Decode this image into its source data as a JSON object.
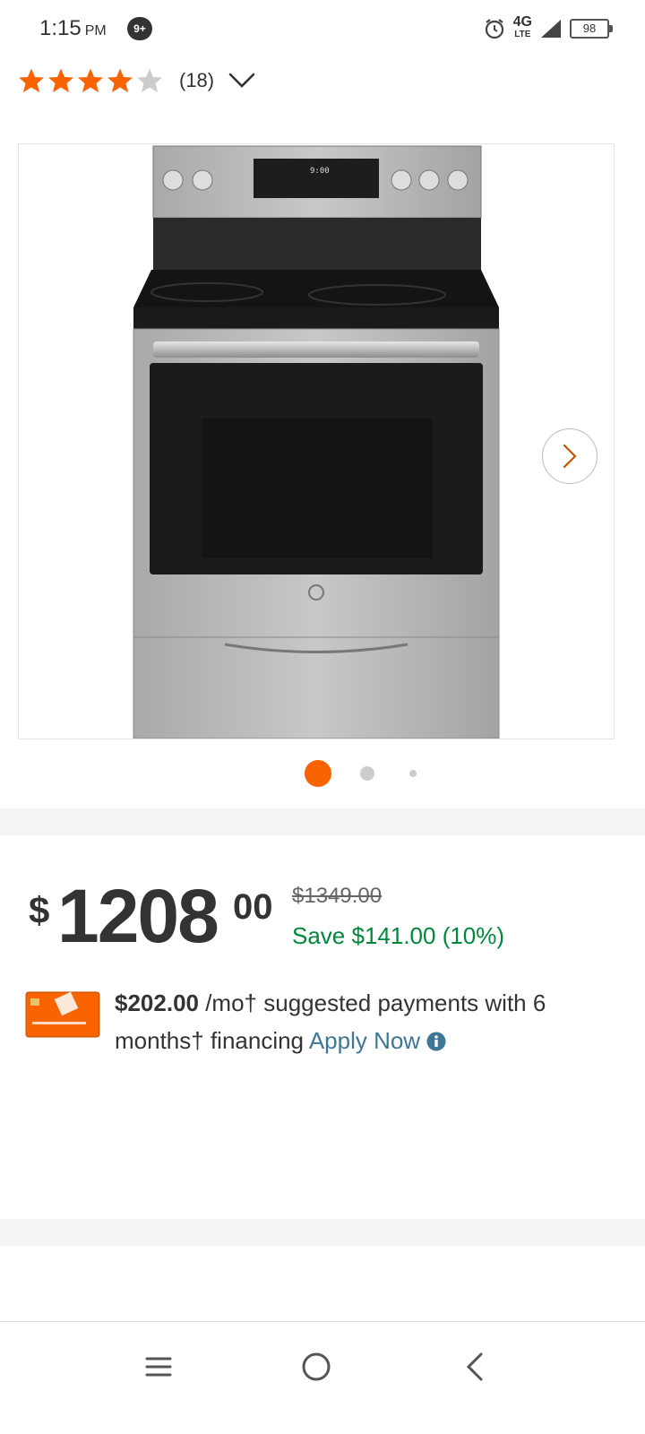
{
  "status_bar": {
    "time": "1:15",
    "ampm": "PM",
    "notification_badge": "9+",
    "network": "4G",
    "network_sub": "LTE",
    "battery": "98"
  },
  "rating": {
    "stars_filled": 4,
    "stars_total": 5,
    "review_count": "(18)"
  },
  "carousel": {
    "image_icon": "range-oven-image",
    "current_index": 1,
    "count": 3
  },
  "price": {
    "currency": "$",
    "dollars": "1208",
    "cents": "00",
    "was_price": "$1349.00",
    "savings": "Save $141.00 (10%)"
  },
  "financing": {
    "amount": "$202.00",
    "text": " /mo† suggested payments with 6 months† financing ",
    "apply_label": "Apply Now"
  },
  "colors": {
    "brand_orange": "#f96302",
    "savings_green": "#00873c",
    "link_blue": "#3e7697"
  }
}
